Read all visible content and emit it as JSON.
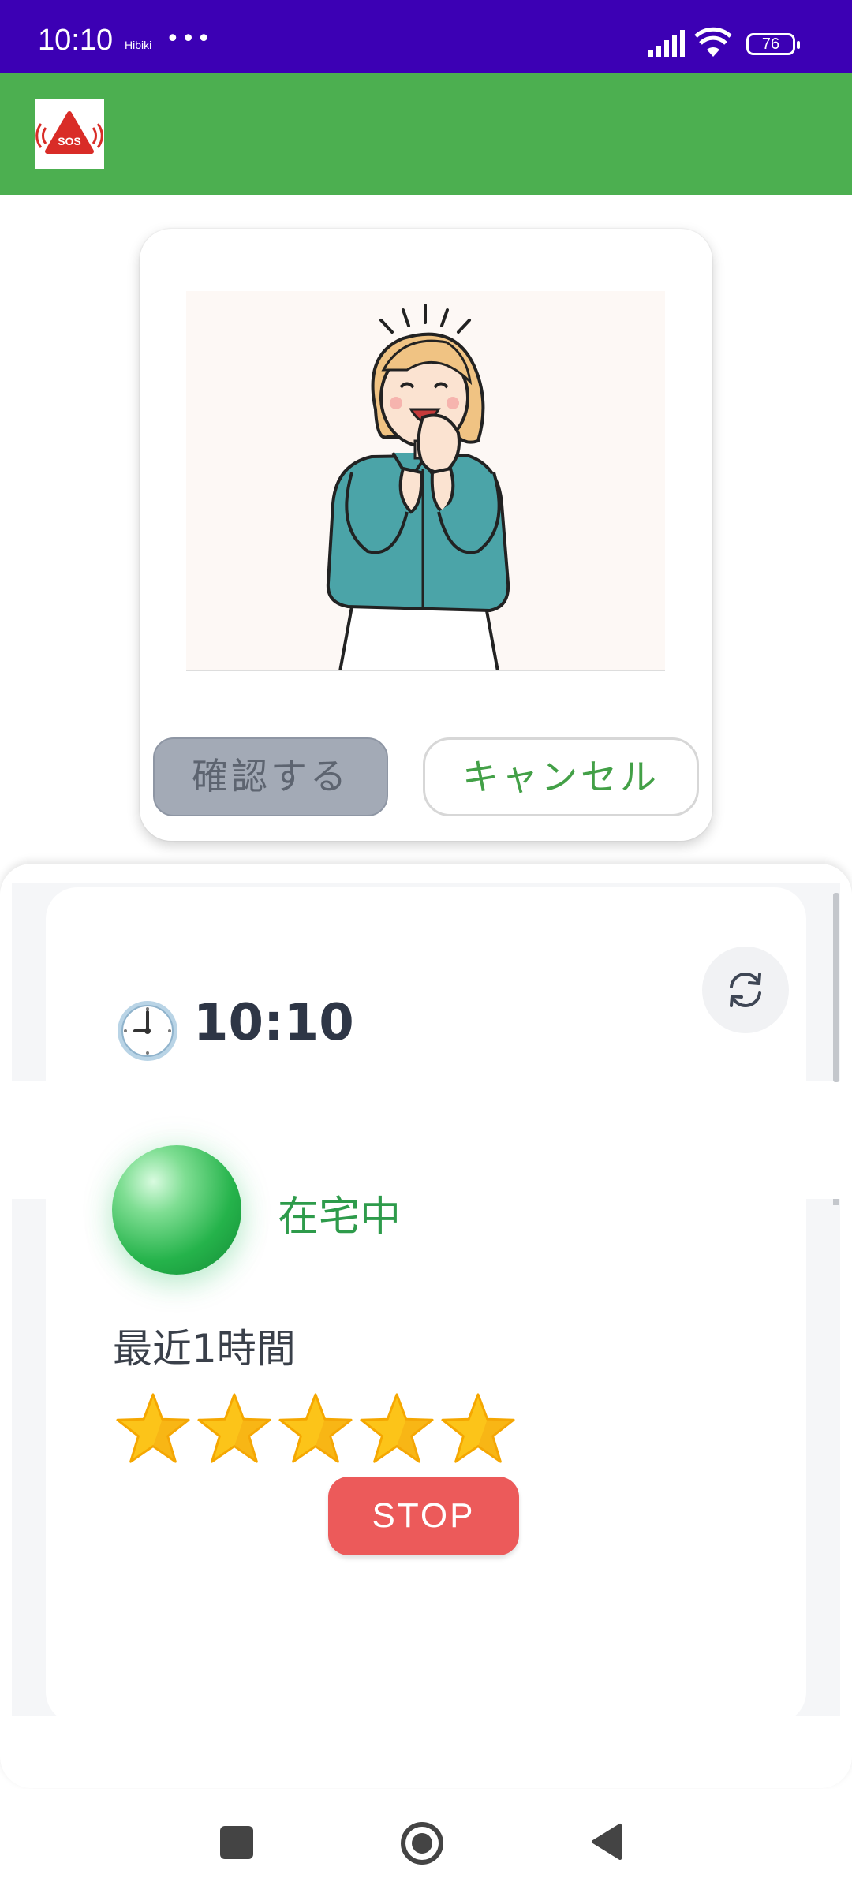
{
  "status_bar": {
    "time": "10:10",
    "carrier": "Hibiki",
    "more": "•••",
    "battery": "76",
    "icons": [
      "signal-icon",
      "wifi-icon",
      "battery-icon"
    ]
  },
  "app_bar": {
    "logo_text": "SOS",
    "color": "#4caf50"
  },
  "dialog": {
    "illustration": "happy-woman-illustration",
    "confirm_label": "確認する",
    "cancel_label": "キャンセル"
  },
  "status_panel": {
    "time": "10:10",
    "clock_icon": "clock-icon",
    "presence_status": "在宅中",
    "presence_color": "#2e9b4b",
    "recent_label": "最近1時間",
    "stars_count": 5,
    "stop_label": "STOP"
  },
  "nav_bar": {
    "icons": [
      "recents-icon",
      "home-icon",
      "back-icon"
    ]
  }
}
